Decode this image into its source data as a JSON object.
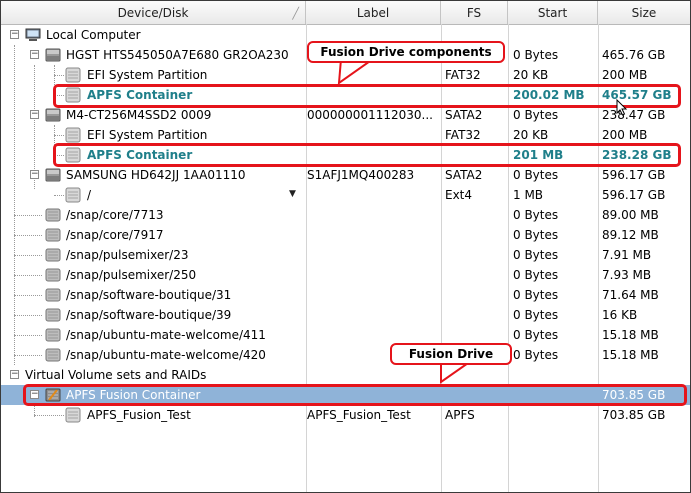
{
  "columns": {
    "device": "Device/Disk",
    "label": "Label",
    "fs": "FS",
    "start": "Start",
    "size": "Size"
  },
  "rows": [
    {
      "name": "Local Computer",
      "label": "",
      "fs": "",
      "start": "",
      "size": "",
      "icon": "computer-icon"
    },
    {
      "name": "HGST HTS545050A7E680 GR2OA230",
      "label": "",
      "fs": "",
      "start": "0 Bytes",
      "size": "465.76 GB",
      "icon": "hard-drive-icon"
    },
    {
      "name": "EFI System Partition",
      "label": "",
      "fs": "FAT32",
      "start": "20 KB",
      "size": "200 MB",
      "icon": "partition-icon"
    },
    {
      "name": "APFS Container",
      "label": "",
      "fs": "",
      "start": "200.02 MB",
      "size": "465.57 GB",
      "icon": "partition-icon"
    },
    {
      "name": "M4-CT256M4SSD2 0009",
      "label": "000000001112030...",
      "fs": "SATA2",
      "start": "0 Bytes",
      "size": "238.47 GB",
      "icon": "hard-drive-icon"
    },
    {
      "name": "EFI System Partition",
      "label": "",
      "fs": "FAT32",
      "start": "20 KB",
      "size": "200 MB",
      "icon": "partition-icon"
    },
    {
      "name": "APFS Container",
      "label": "",
      "fs": "",
      "start": "201 MB",
      "size": "238.28 GB",
      "icon": "partition-icon"
    },
    {
      "name": "SAMSUNG HD642JJ 1AA01110",
      "label": "S1AFJ1MQ400283",
      "fs": "SATA2",
      "start": "0 Bytes",
      "size": "596.17 GB",
      "icon": "hard-drive-icon"
    },
    {
      "name": "/",
      "label": "",
      "fs": "Ext4",
      "start": "1 MB",
      "size": "596.17 GB",
      "icon": "partition-icon"
    },
    {
      "name": "/snap/core/7713",
      "label": "",
      "fs": "",
      "start": "0 Bytes",
      "size": "89.00 MB",
      "icon": "disk-image-icon"
    },
    {
      "name": "/snap/core/7917",
      "label": "",
      "fs": "",
      "start": "0 Bytes",
      "size": "89.12 MB",
      "icon": "disk-image-icon"
    },
    {
      "name": "/snap/pulsemixer/23",
      "label": "",
      "fs": "",
      "start": "0 Bytes",
      "size": "7.91 MB",
      "icon": "disk-image-icon"
    },
    {
      "name": "/snap/pulsemixer/250",
      "label": "",
      "fs": "",
      "start": "0 Bytes",
      "size": "7.93 MB",
      "icon": "disk-image-icon"
    },
    {
      "name": "/snap/software-boutique/31",
      "label": "",
      "fs": "",
      "start": "0 Bytes",
      "size": "71.64 MB",
      "icon": "disk-image-icon"
    },
    {
      "name": "/snap/software-boutique/39",
      "label": "",
      "fs": "",
      "start": "0 Bytes",
      "size": "16 KB",
      "icon": "disk-image-icon"
    },
    {
      "name": "/snap/ubuntu-mate-welcome/411",
      "label": "",
      "fs": "",
      "start": "0 Bytes",
      "size": "15.18 MB",
      "icon": "disk-image-icon"
    },
    {
      "name": "/snap/ubuntu-mate-welcome/420",
      "label": "",
      "fs": "",
      "start": "0 Bytes",
      "size": "15.18 MB",
      "icon": "disk-image-icon"
    },
    {
      "name": "Virtual Volume sets and RAIDs",
      "label": "",
      "fs": "",
      "start": "",
      "size": "",
      "icon": ""
    },
    {
      "name": "APFS Fusion Container",
      "label": "",
      "fs": "",
      "start": "",
      "size": "703.85 GB",
      "icon": "fusion-container-icon"
    },
    {
      "name": "APFS_Fusion_Test",
      "label": "APFS_Fusion_Test",
      "fs": "APFS",
      "start": "",
      "size": "703.85 GB",
      "icon": "partition-icon"
    }
  ],
  "callouts": {
    "fusion_components": "Fusion Drive components",
    "fusion_drive": "Fusion Drive"
  },
  "colors": {
    "apfs_text": "#1f7f8a",
    "highlight_border": "#e5141b",
    "selection": "#8fb3d8"
  }
}
